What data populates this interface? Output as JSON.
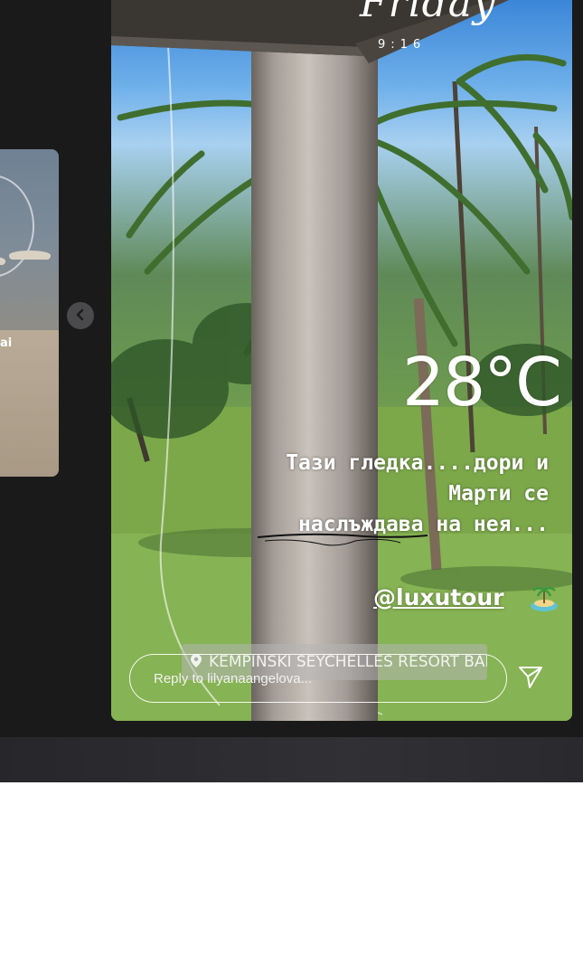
{
  "previous_story": {
    "label": "ai"
  },
  "story": {
    "day_label": "Friday",
    "time_label": "9:16",
    "temperature": "28°C",
    "caption_lines": [
      "Тази гледка....дори и",
      "Марти се",
      "наслъждава на нея..."
    ],
    "mention": "@luxutour",
    "location": "KEMPINSKI SEYCHELLES RESORT BAI...",
    "reply_placeholder": "Reply to lilyanaangelova..."
  },
  "icons": {
    "previous": "chevron-left-icon",
    "send": "paper-plane-icon",
    "location": "location-pin-icon",
    "island": "island-sticker-icon"
  }
}
